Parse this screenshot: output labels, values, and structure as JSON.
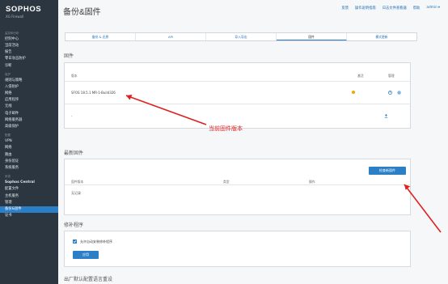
{
  "brand": {
    "name": "SOPHOS",
    "product": "XG Firewall"
  },
  "sidebar": {
    "sections": [
      {
        "label": "监控和分析",
        "items": [
          "控制中心",
          "当前活动",
          "报告",
          "零日攻击防护",
          "诊断"
        ]
      },
      {
        "label": "保护",
        "items": [
          "规则与策略",
          "入侵防护",
          "网络",
          "应用程序",
          "无线",
          "电子邮件",
          "网络服务器",
          "高级保护"
        ]
      },
      {
        "label": "配置",
        "items": [
          "VPN",
          "网络",
          "路由",
          "身份验证",
          "系统服务"
        ]
      },
      {
        "label": "系统",
        "items": [
          "Sophos Central",
          "配置文件",
          "主机服务",
          "管理",
          "备份&固件",
          "证书"
        ]
      }
    ]
  },
  "page": {
    "title": "备份&固件",
    "toplinks": {
      "feedback": "反馈",
      "guide": "操作说明指南",
      "logs": "日志文件查看器",
      "help": "帮助",
      "user": "admin"
    },
    "tabs": [
      "备份 & 还原",
      "API",
      "导入导出",
      "固件",
      "模式更新"
    ],
    "active_tab": "固件"
  },
  "firmware": {
    "section_title": "固件",
    "columns": {
      "version": "版本",
      "active": "激活",
      "manage": "管理"
    },
    "rows": [
      {
        "version": "SFOS 18.5.1 MR-1-Build326"
      },
      {
        "version": "-"
      }
    ]
  },
  "latest": {
    "section_title": "最新固件",
    "check_button": "检查新固件",
    "columns": {
      "version": "固件版本",
      "type": "类型",
      "action": "操作"
    },
    "empty": "无记录"
  },
  "hotfix": {
    "section_title": "修补程序",
    "checkbox_label": "允许自动安装修补程序",
    "apply_button": "应用"
  },
  "factory": {
    "section_title": "出厂默认配置语言重设"
  },
  "annotation": {
    "text": "当前固件版本"
  },
  "colors": {
    "sidebar": "#2b3640",
    "accent": "#2a7fc6",
    "annotation": "#e02020",
    "status_dot": "#f0a800"
  }
}
